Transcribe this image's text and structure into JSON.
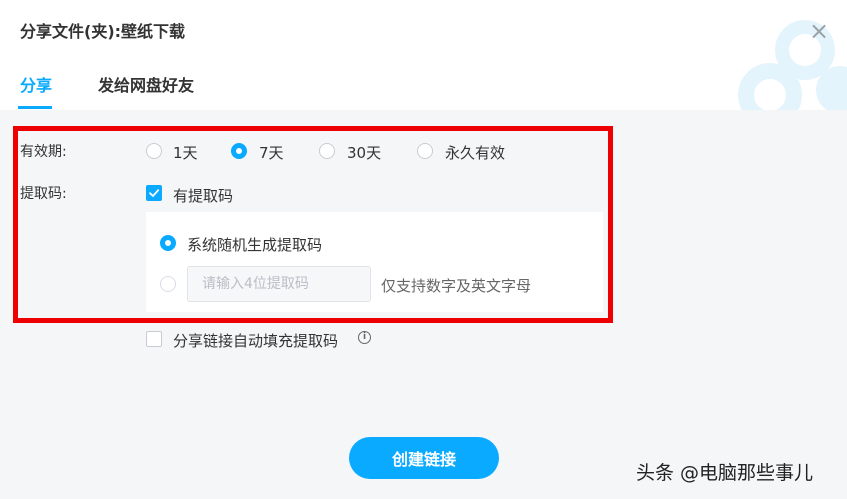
{
  "dialog": {
    "title": "分享文件(夹):壁纸下载",
    "close_icon": "close-icon"
  },
  "tabs": [
    {
      "label": "分享",
      "active": true
    },
    {
      "label": "发给网盘好友",
      "active": false
    }
  ],
  "validity": {
    "label": "有效期:",
    "options": [
      "1天",
      "7天",
      "30天",
      "永久有效"
    ],
    "selected": "7天"
  },
  "extract_code": {
    "label": "提取码:",
    "checkbox_label": "有提取码",
    "checked": true,
    "random_option": "系统随机生成提取码",
    "random_selected": true,
    "custom_placeholder": "请输入4位提取码",
    "custom_hint": "仅支持数字及英文字母"
  },
  "auto_fill": {
    "label": "分享链接自动填充提取码",
    "checked": false,
    "info_icon": "info-icon"
  },
  "create_button": "创建链接",
  "watermark": "头条 @电脑那些事儿",
  "colors": {
    "accent": "#09aaff",
    "highlight_box": "#ee0000",
    "background": "#f5f6f8"
  }
}
